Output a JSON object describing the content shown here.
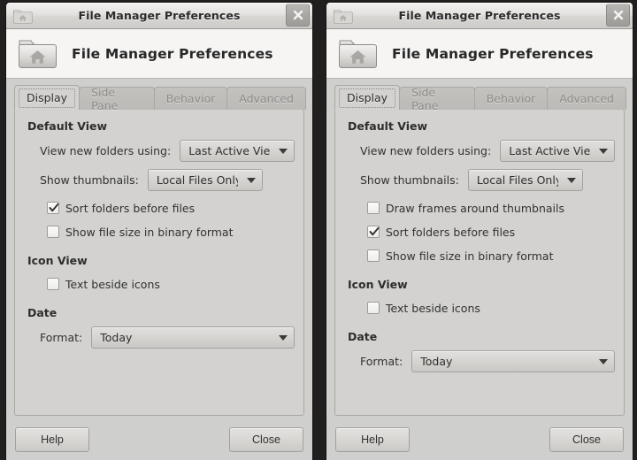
{
  "windows": [
    {
      "id": "left",
      "titlebar": {
        "title": "File Manager Preferences",
        "app_icon": "folder-home-icon",
        "close_icon": "close-icon"
      },
      "banner": {
        "title": "File Manager Preferences",
        "icon": "folder-home-icon"
      },
      "tabs": [
        {
          "label": "Display",
          "active": true
        },
        {
          "label": "Side Pane",
          "active": false
        },
        {
          "label": "Behavior",
          "active": false
        },
        {
          "label": "Advanced",
          "active": false
        }
      ],
      "groups": [
        {
          "title": "Default View",
          "combos": [
            {
              "label": "View new folders using:",
              "value": "Last Active View"
            },
            {
              "label": "Show thumbnails:",
              "value": "Local Files Only"
            }
          ],
          "checkboxes": [
            {
              "label": "Sort folders before files",
              "checked": true
            },
            {
              "label": "Show file size in binary format",
              "checked": false
            }
          ]
        },
        {
          "title": "Icon View",
          "combos": [],
          "checkboxes": [
            {
              "label": "Text beside icons",
              "checked": false
            }
          ]
        },
        {
          "title": "Date",
          "combos": [
            {
              "label": "Format:",
              "value": "Today",
              "wide": true
            }
          ],
          "checkboxes": []
        }
      ],
      "actions": {
        "help_label": "Help",
        "close_label": "Close"
      }
    },
    {
      "id": "right",
      "titlebar": {
        "title": "File Manager Preferences",
        "app_icon": "folder-home-icon",
        "close_icon": "close-icon"
      },
      "banner": {
        "title": "File Manager Preferences",
        "icon": "folder-home-icon"
      },
      "tabs": [
        {
          "label": "Display",
          "active": true
        },
        {
          "label": "Side Pane",
          "active": false
        },
        {
          "label": "Behavior",
          "active": false
        },
        {
          "label": "Advanced",
          "active": false
        }
      ],
      "groups": [
        {
          "title": "Default View",
          "combos": [
            {
              "label": "View new folders using:",
              "value": "Last Active View"
            },
            {
              "label": "Show thumbnails:",
              "value": "Local Files Only"
            }
          ],
          "checkboxes": [
            {
              "label": "Draw frames around thumbnails",
              "checked": false
            },
            {
              "label": "Sort folders before files",
              "checked": true
            },
            {
              "label": "Show file size in binary format",
              "checked": false
            }
          ]
        },
        {
          "title": "Icon View",
          "combos": [],
          "checkboxes": [
            {
              "label": "Text beside icons",
              "checked": false
            }
          ]
        },
        {
          "title": "Date",
          "combos": [
            {
              "label": "Format:",
              "value": "Today",
              "wide": true
            }
          ],
          "checkboxes": []
        }
      ],
      "actions": {
        "help_label": "Help",
        "close_label": "Close"
      }
    }
  ],
  "colors": {
    "desktop_background": "#211f1f",
    "window_background": "#cfcfcd",
    "page_background": "#d3d2d0",
    "banner_background": "#f6f5f4",
    "text": "#323232",
    "inactive_tab_text": "#8d8b88"
  }
}
